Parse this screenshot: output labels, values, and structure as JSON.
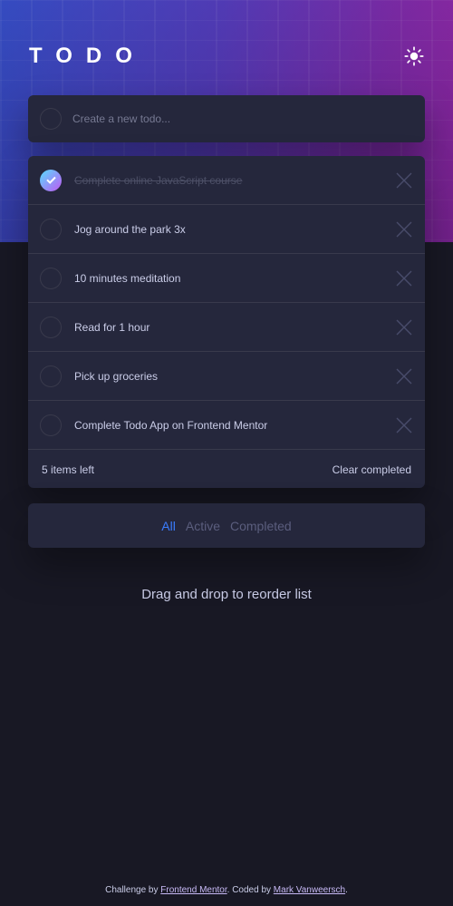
{
  "app": {
    "title": "TODO"
  },
  "new_todo": {
    "placeholder": "Create a new todo..."
  },
  "todos": [
    {
      "text": "Complete online JavaScript course",
      "completed": true
    },
    {
      "text": "Jog around the park 3x",
      "completed": false
    },
    {
      "text": "10 minutes meditation",
      "completed": false
    },
    {
      "text": "Read for 1 hour",
      "completed": false
    },
    {
      "text": "Pick up groceries",
      "completed": false
    },
    {
      "text": "Complete Todo App on Frontend Mentor",
      "completed": false
    }
  ],
  "footer": {
    "items_left": "5 items left",
    "clear_label": "Clear completed"
  },
  "filters": [
    {
      "label": "All",
      "active": true
    },
    {
      "label": "Active",
      "active": false
    },
    {
      "label": "Completed",
      "active": false
    }
  ],
  "hint": "Drag and drop to reorder list",
  "attribution": {
    "prefix": "Challenge by ",
    "link1": "Frontend Mentor",
    "middle": ". Coded by ",
    "link2": "Mark Vanweersch",
    "suffix": "."
  },
  "colors": {
    "background": "#181824",
    "card": "#25273c",
    "accent": "#3a7cfd",
    "check_gradient_start": "#57ddff",
    "check_gradient_end": "#c058f3"
  },
  "icons": {
    "theme_toggle": "sun-icon",
    "delete": "cross-icon",
    "check": "check-icon"
  }
}
